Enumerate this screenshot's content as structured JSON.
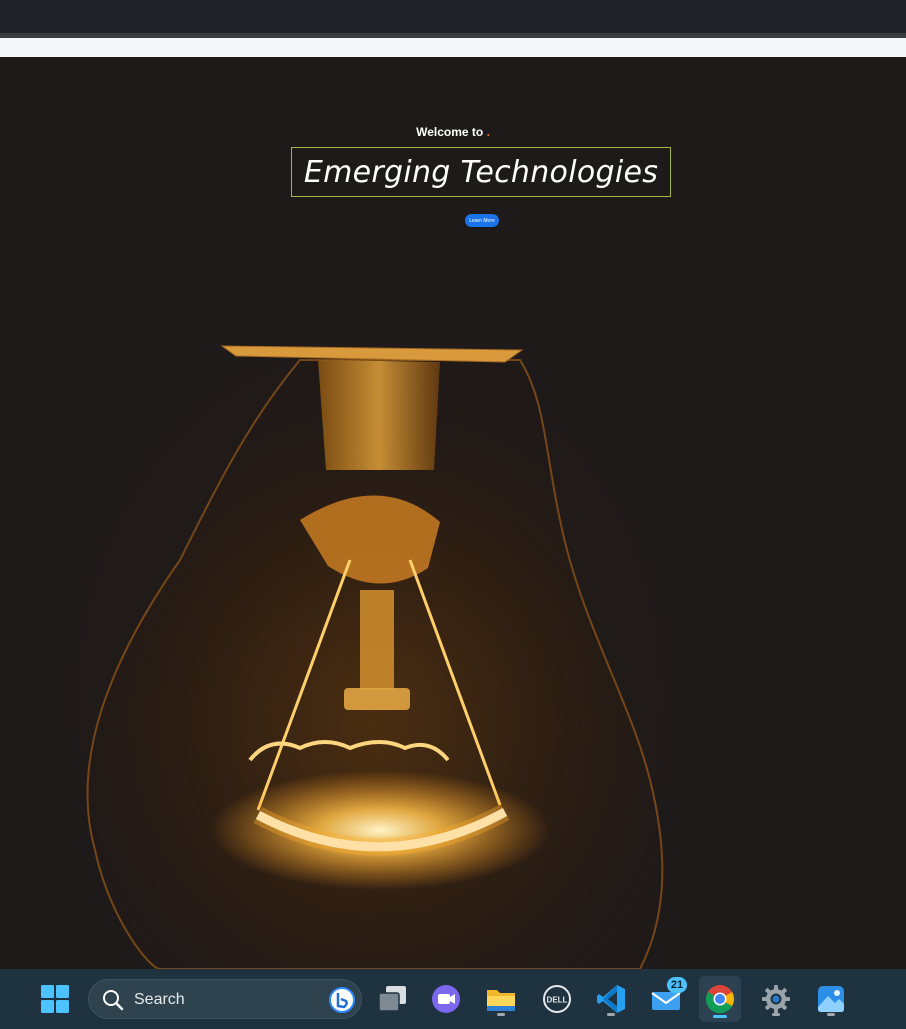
{
  "hero": {
    "welcome": "Welcome to",
    "welcome_dot": ".",
    "title": "Emerging Technologies",
    "button_label": "Learn More"
  },
  "taskbar": {
    "search_placeholder": "Search",
    "apps": [
      {
        "icon": "windows-start-icon"
      },
      {
        "icon": "task-view-icon"
      },
      {
        "icon": "video-chat-icon"
      },
      {
        "icon": "file-explorer-icon"
      },
      {
        "icon": "dell-icon"
      },
      {
        "icon": "vscode-icon"
      },
      {
        "icon": "mail-icon",
        "badge": "21"
      },
      {
        "icon": "chrome-icon"
      },
      {
        "icon": "settings-icon"
      },
      {
        "icon": "photos-icon"
      }
    ]
  },
  "colors": {
    "accent": "#1a73e8",
    "title_border": "#9fb83c",
    "welcome_dot": "#e8772e",
    "taskbar": "#1e3240"
  }
}
